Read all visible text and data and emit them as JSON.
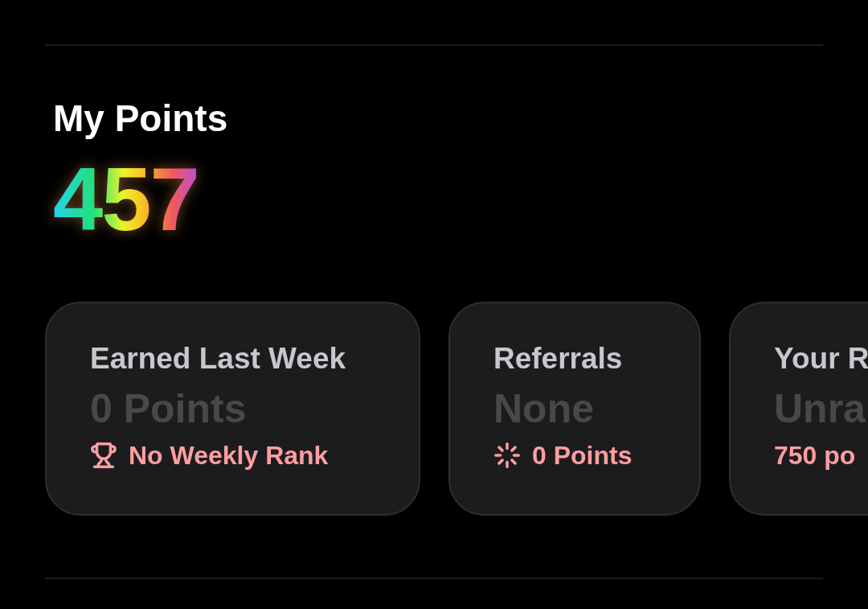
{
  "title": "My Points",
  "points": "457",
  "cards": [
    {
      "label": "Earned Last Week",
      "value": "0 Points",
      "note": "No Weekly Rank",
      "kind": "rank"
    },
    {
      "label": "Referrals",
      "value": "None",
      "note": "0 Points",
      "kind": "referral"
    },
    {
      "label": "Your R",
      "value": "Unra",
      "note": "750 po",
      "kind": "plain"
    }
  ]
}
